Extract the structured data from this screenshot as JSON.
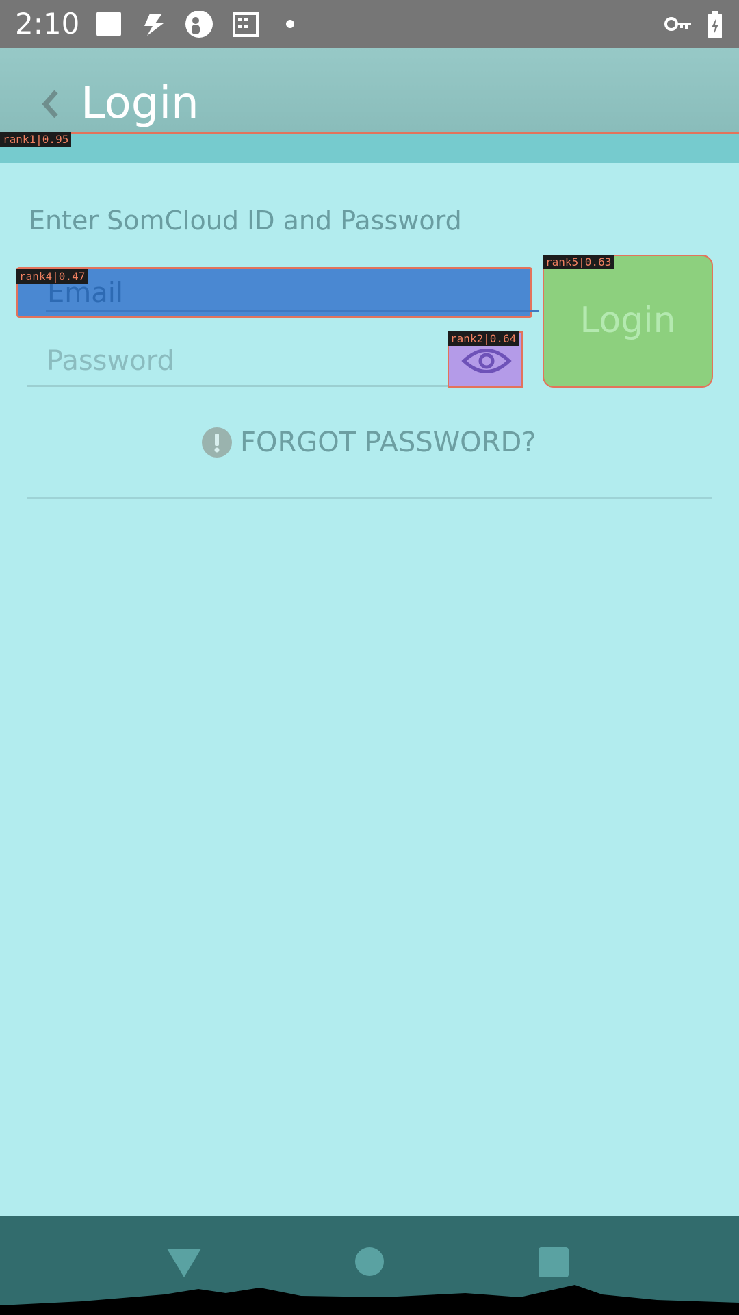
{
  "statusbar": {
    "time": "2:10"
  },
  "appbar": {
    "title": "Login"
  },
  "form": {
    "prompt": "Enter SomCloud ID and Password",
    "email_placeholder": "Email",
    "password_placeholder": "Password",
    "login_label": "Login",
    "forgot_label": "FORGOT PASSWORD?"
  },
  "overlay_tags": {
    "rank1": "rank1|0.95",
    "rank2": "rank2|0.64",
    "rank4": "rank4|0.47",
    "rank5": "rank5|0.63"
  },
  "colors": {
    "background": "#b2ecee",
    "appbar": "#8dbfbd",
    "email_highlight": "#4a88d2",
    "login_highlight": "#8dd07e",
    "eye_highlight": "#b49be8",
    "navbar": "#326c6d"
  },
  "icons": [
    "photo-icon",
    "bolt-icon",
    "account-icon",
    "building-icon",
    "dot-icon",
    "key-icon",
    "battery-charging-icon",
    "back-chevron-icon",
    "eye-icon",
    "alert-icon",
    "nav-back-icon",
    "nav-home-icon",
    "nav-recents-icon"
  ]
}
